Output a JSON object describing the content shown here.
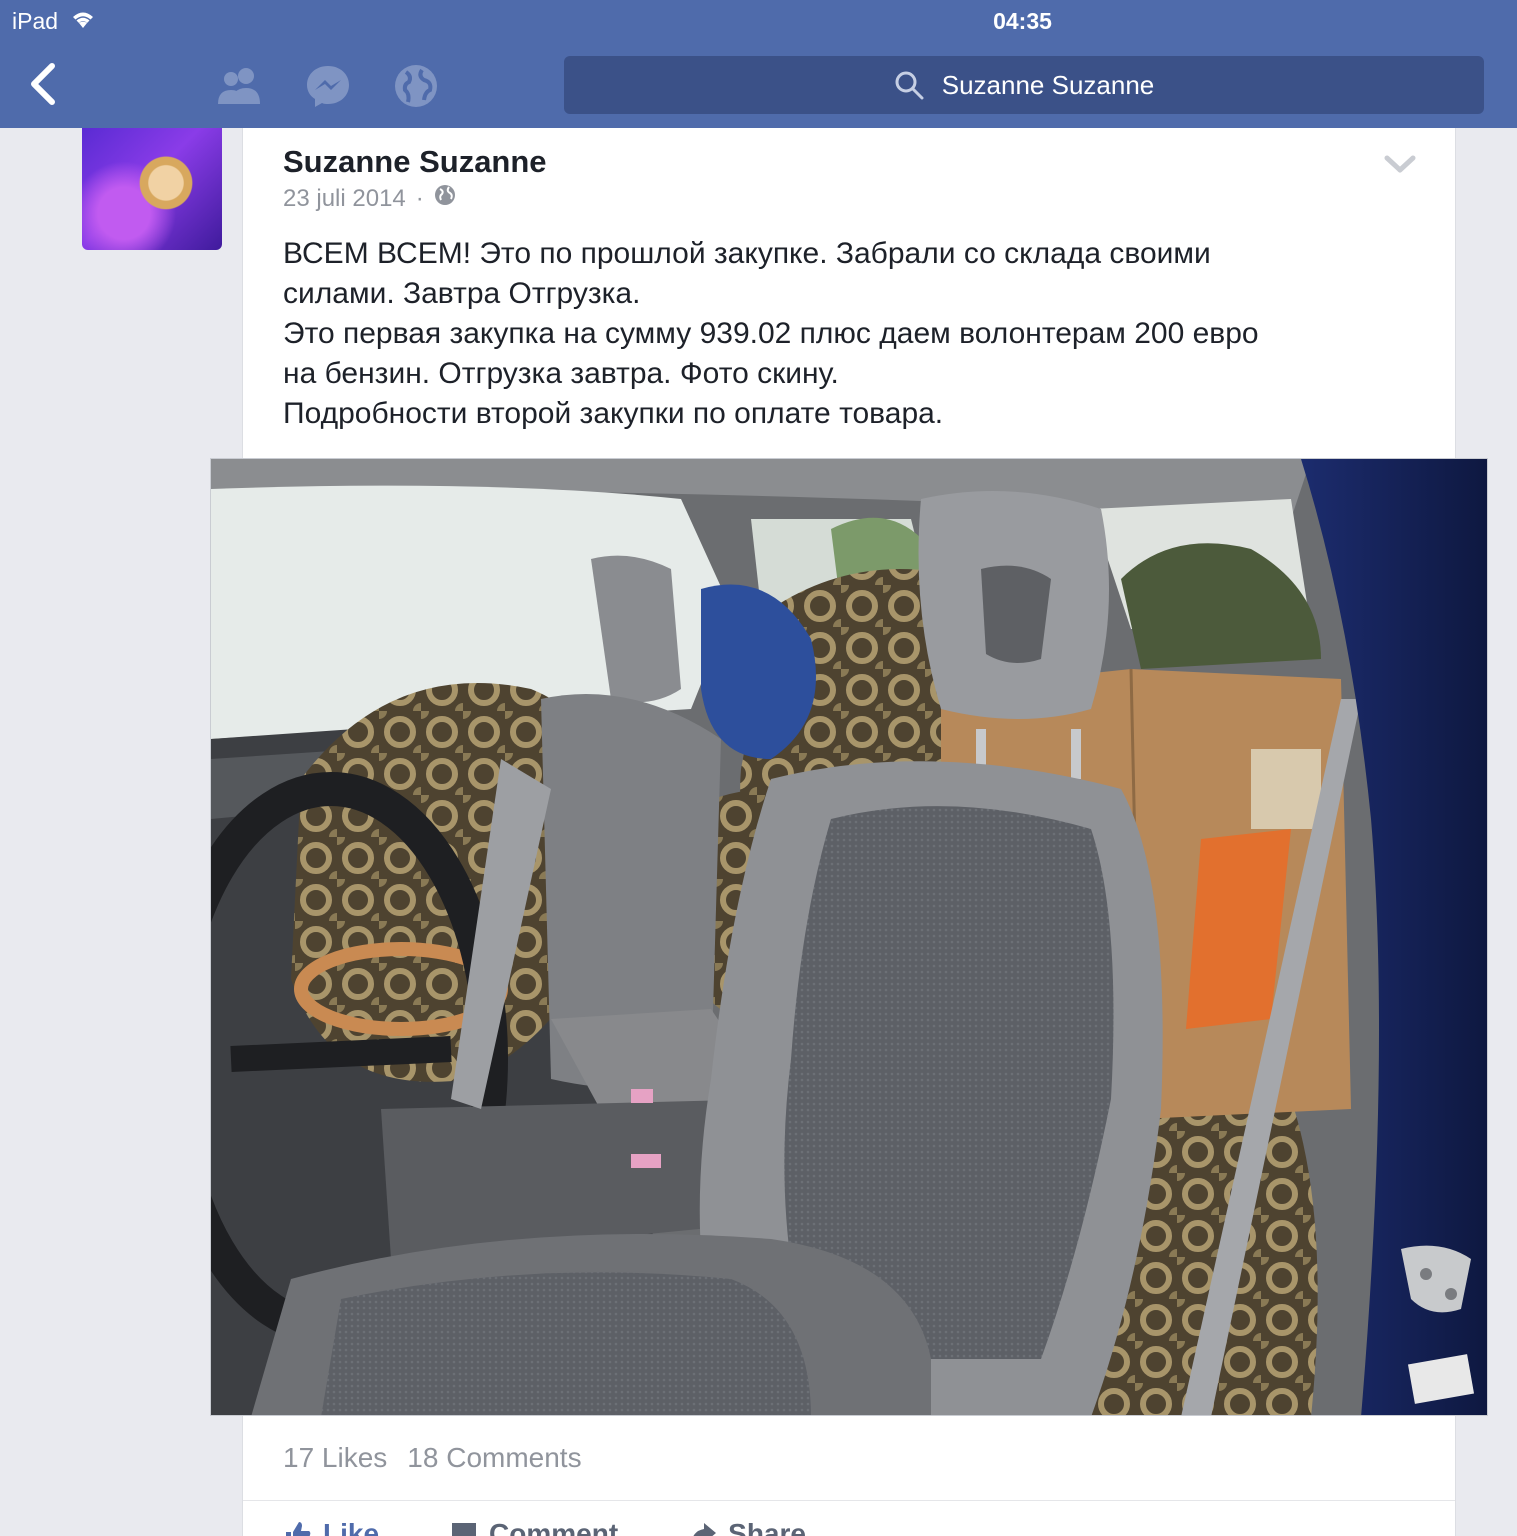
{
  "statusbar": {
    "carrier": "iPad",
    "time": "04:35"
  },
  "navbar": {
    "back_icon": "chevron-left-icon",
    "icons": [
      "friends-icon",
      "messenger-icon",
      "globe-icon"
    ],
    "search_value": "Suzanne Suzanne"
  },
  "post": {
    "author": "Suzanne Suzanne",
    "date": "23 juli 2014",
    "separator": "·",
    "privacy_icon": "globe-icon",
    "text_lines": [
      "ВСЕМ ВСЕМ! Это по прошлой закупке. Забрали со склада своими",
      "силами. Завтра Отгрузка.",
      "Это первая закупка на сумму 939.02 плюс даем волонтерам 200 евро",
      "на бензин. Отгрузка завтра. Фото скину.",
      "Подробности второй закупки по оплате товара."
    ],
    "stats": {
      "likes": "17 Likes",
      "comments": "18 Comments"
    },
    "actions": {
      "like": "Like",
      "comment": "Comment",
      "share": "Share"
    }
  },
  "colors": {
    "brand": "#4f6bab",
    "search_bg": "#3b5188",
    "page_bg": "#e9eaef"
  }
}
